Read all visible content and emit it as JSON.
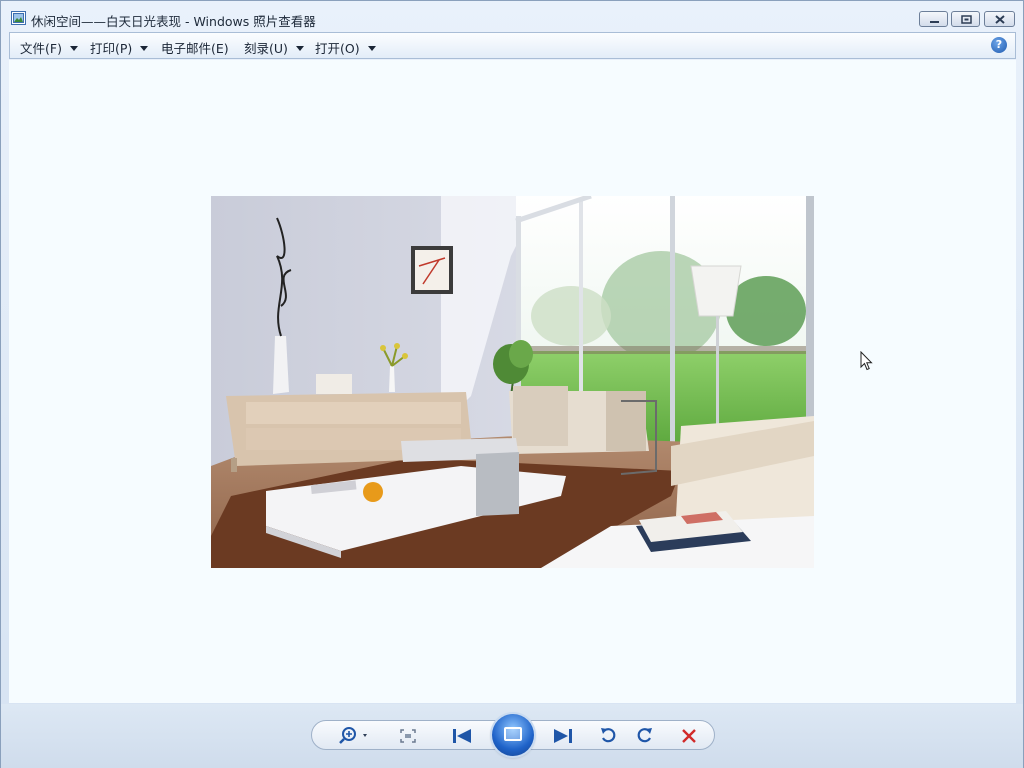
{
  "window": {
    "title": "休闲空间——白天日光表现 - Windows 照片查看器"
  },
  "menu": {
    "items": [
      {
        "label": "文件(F)",
        "has_dropdown": true
      },
      {
        "label": "打印(P)",
        "has_dropdown": true
      },
      {
        "label": "电子邮件(E)",
        "has_dropdown": false
      },
      {
        "label": "刻录(U)",
        "has_dropdown": true
      },
      {
        "label": "打开(O)",
        "has_dropdown": true
      }
    ],
    "help_label": "?"
  },
  "toolbar": {
    "controls": [
      "zoom-icon",
      "actual-size-icon",
      "previous-icon",
      "slideshow-icon",
      "next-icon",
      "rotate-counterclockwise-icon",
      "rotate-clockwise-icon",
      "delete-icon"
    ]
  },
  "colors": {
    "accent_blue": "#1f63c9",
    "delete_red": "#d12a2a"
  }
}
